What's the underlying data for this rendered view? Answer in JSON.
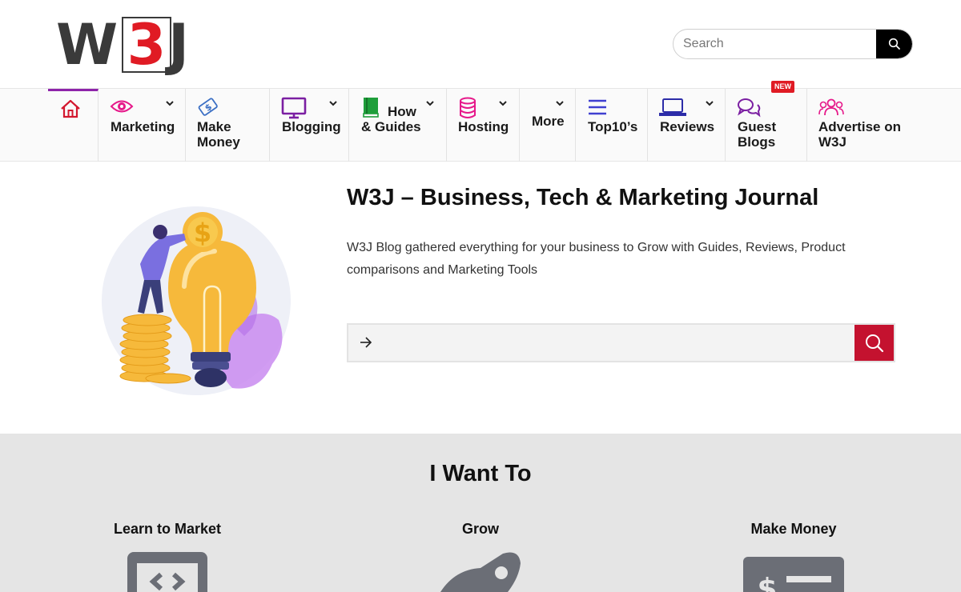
{
  "header": {
    "logo_text": "W3J",
    "search_placeholder": "Search"
  },
  "nav": {
    "items": [
      {
        "label": "",
        "icon": "home-icon"
      },
      {
        "label": "Marketing",
        "icon": "eye-icon"
      },
      {
        "label_line1": "Make",
        "label_line2": "Money",
        "icon": "money-icon"
      },
      {
        "label": "Blogging",
        "icon": "monitor-icon"
      },
      {
        "label_line1": "How",
        "label_line2": "& Guides",
        "icon": "book-icon"
      },
      {
        "label": "Hosting",
        "icon": "database-icon"
      },
      {
        "label": "More"
      },
      {
        "label": "Top10’s",
        "icon": "list-icon"
      },
      {
        "label": "Reviews",
        "icon": "laptop-icon"
      },
      {
        "label_line1": "Guest",
        "label_line2": "Blogs",
        "icon": "chat-icon",
        "badge": "NEW"
      },
      {
        "label_line1": "Advertise on",
        "label_line2": "W3J",
        "icon": "users-icon"
      }
    ]
  },
  "hero": {
    "title": "W3J – Business, Tech & Marketing Journal",
    "description": "W3J Blog gathered everything for your business to Grow with Guides, Reviews, Product comparisons and Marketing Tools",
    "search_placeholder": ""
  },
  "iwant": {
    "title": "I Want To",
    "columns": [
      {
        "label": "Learn to Market",
        "icon": "code-window-icon"
      },
      {
        "label": "Grow",
        "icon": "rocket-icon"
      },
      {
        "label": "Make Money",
        "icon": "dollar-check-icon"
      }
    ]
  },
  "colors": {
    "accent_red": "#c4122f",
    "brand_purple": "#8e24aa",
    "section_gray": "#e5e5e5"
  }
}
